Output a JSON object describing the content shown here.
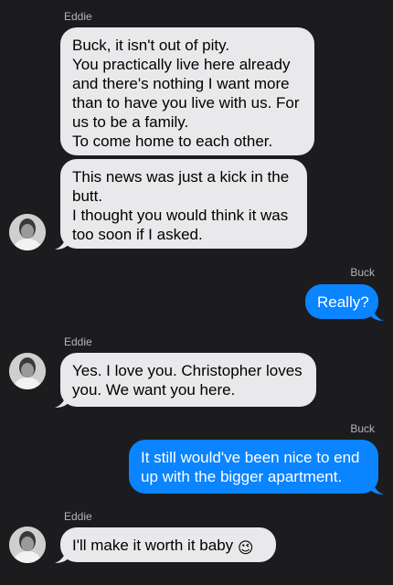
{
  "conversation": {
    "contact_name": "Eddie",
    "self_name": "Buck",
    "messages": [
      {
        "sender": "Eddie",
        "lines": [
          "Buck, it isn't out of pity.",
          "You practically live here already",
          "and there's nothing I want more",
          "than to have you live with us. For",
          "us to be a family.",
          "To come home to each other."
        ]
      },
      {
        "sender": "Eddie",
        "lines": [
          "This news was just a kick in the",
          "butt.",
          "I thought you would think it was",
          "too soon if I asked."
        ]
      },
      {
        "sender": "Buck",
        "lines": [
          "Really?"
        ]
      },
      {
        "sender": "Eddie",
        "lines": [
          "Yes. I love you. Christopher loves",
          "you. We want you here."
        ]
      },
      {
        "sender": "Buck",
        "lines": [
          "It still would've been nice to end",
          "up with the bigger apartment."
        ]
      },
      {
        "sender": "Eddie",
        "lines": [
          "I'll make it worth it baby"
        ],
        "emoji": "😉"
      }
    ]
  },
  "colors": {
    "background": "#1c1c1e",
    "incoming_bubble": "#e9e9eb",
    "outgoing_bubble": "#0a84ff",
    "sender_label": "#b5b5b8"
  }
}
